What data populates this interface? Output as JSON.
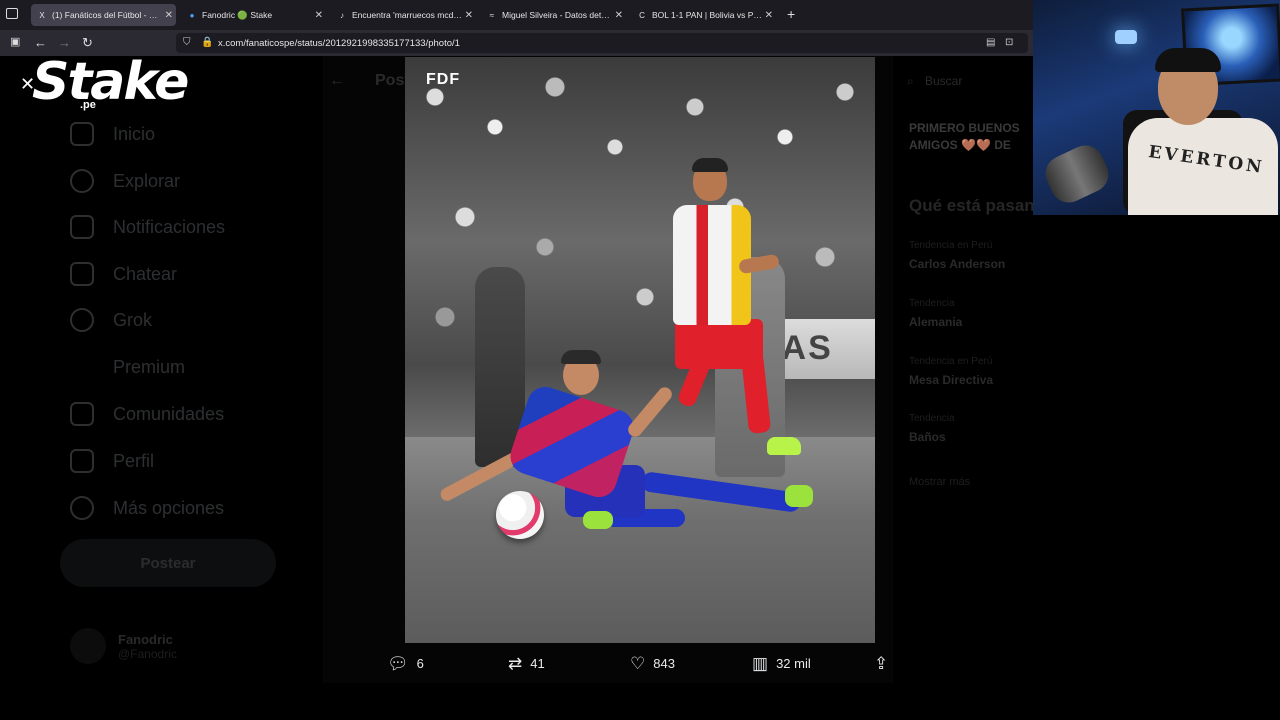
{
  "browser": {
    "tabs": [
      {
        "title": "(1) Fanáticos del Fútbol - Perú e",
        "favicon": "X"
      },
      {
        "title": "Fanodric 🟢 Stake",
        "favicon": "●"
      },
      {
        "title": "Encuentra 'marruecos mcdonal",
        "favicon": "♪"
      },
      {
        "title": "Miguel Silveira - Datos detallad",
        "favicon": "≈"
      },
      {
        "title": "BOL 1-1 PAN | Bolivia vs Panam",
        "favicon": "C"
      }
    ],
    "url": "x.com/fanaticospe/status/2012921998335177133/photo/1"
  },
  "sidebar": {
    "items": [
      {
        "label": "Inicio",
        "icon": "home-icon"
      },
      {
        "label": "Explorar",
        "icon": "search-icon"
      },
      {
        "label": "Notificaciones",
        "icon": "bell-icon"
      },
      {
        "label": "Chatear",
        "icon": "mail-icon"
      },
      {
        "label": "Grok",
        "icon": "grok-icon"
      },
      {
        "label": "Premium",
        "icon": "x-logo-icon"
      },
      {
        "label": "Comunidades",
        "icon": "people-icon"
      },
      {
        "label": "Perfil",
        "icon": "user-icon"
      },
      {
        "label": "Más opciones",
        "icon": "more-icon"
      }
    ],
    "post_button": "Postear",
    "profile_name": "Fanodric",
    "profile_handle": "@Fanodric"
  },
  "center_ghost": {
    "back_label": "Post"
  },
  "right": {
    "search_placeholder": "Buscar",
    "snippet": "PRIMERO BUENOS AMIGOS 🤎🤎 DE",
    "whats_happening": "Qué está pasando",
    "trends": [
      {
        "small": "Tendencia en Perú",
        "bold": "Carlos Anderson"
      },
      {
        "small": "Tendencia",
        "bold": "Alemania"
      },
      {
        "small": "Tendencia en Perú",
        "bold": "Mesa Directiva"
      },
      {
        "small": "Tendencia",
        "bold": "Baños"
      }
    ],
    "more_label": "Mostrar más"
  },
  "photo": {
    "watermark": "FDF",
    "ad_text": "RAS"
  },
  "overlay": {
    "brand": "Stake",
    "brand_sub": ".pe"
  },
  "actions": {
    "replies": "6",
    "reposts": "41",
    "likes": "843",
    "views": "32 mil"
  },
  "webcam": {
    "shirt_text": "EVERTON"
  }
}
